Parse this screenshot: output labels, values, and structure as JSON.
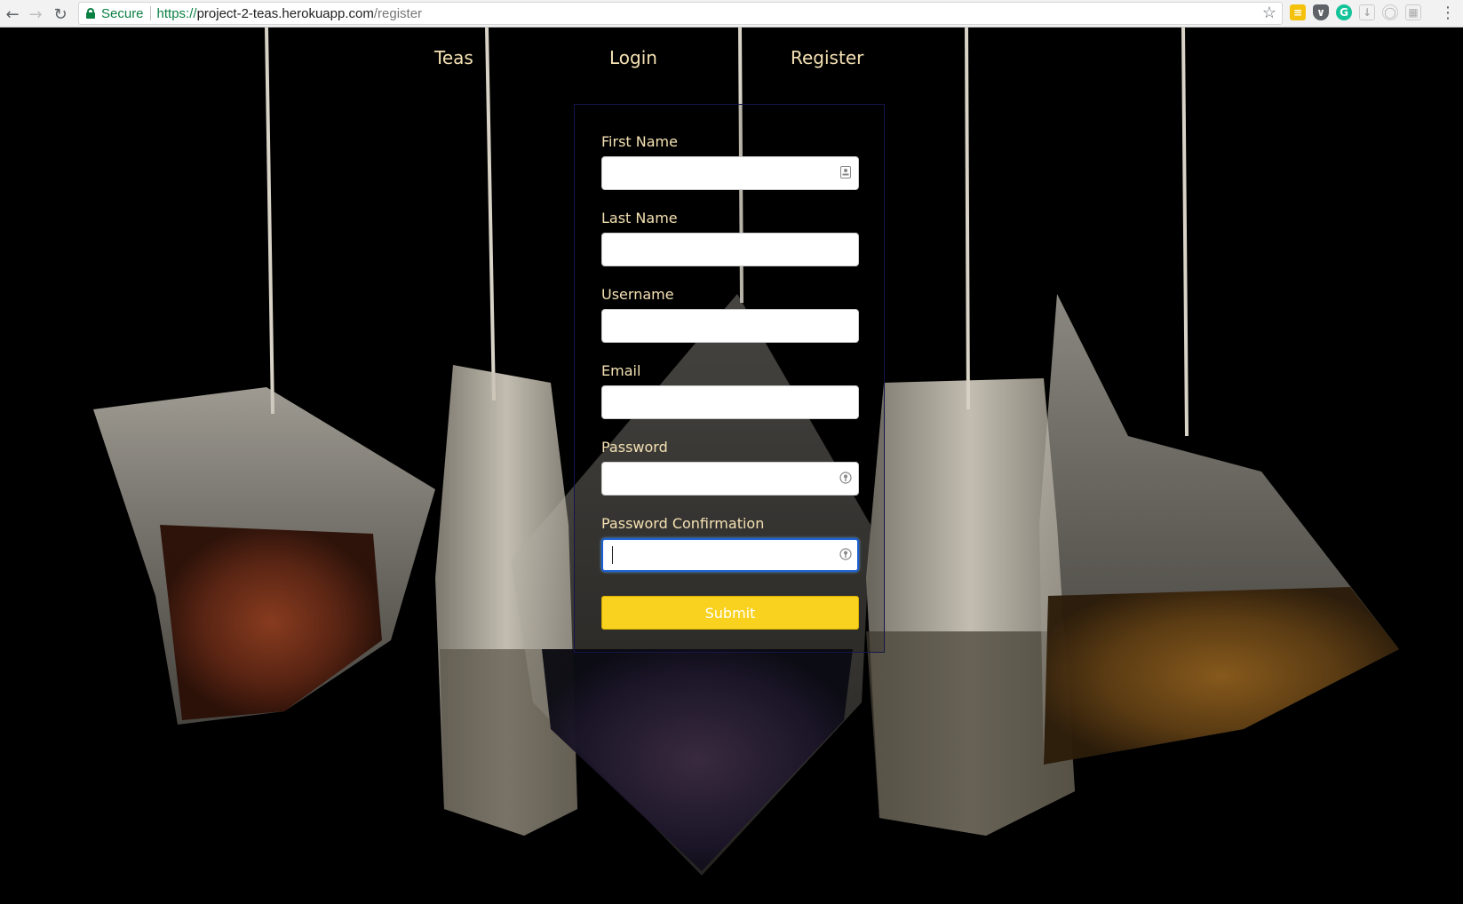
{
  "browser": {
    "secure_label": "Secure",
    "url_scheme": "https://",
    "url_host": "project-2-teas.herokuapp.com",
    "url_path": "/register"
  },
  "nav": {
    "teas": "Teas",
    "login": "Login",
    "register": "Register"
  },
  "form": {
    "first_name_label": "First Name",
    "last_name_label": "Last Name",
    "username_label": "Username",
    "email_label": "Email",
    "password_label": "Password",
    "password_confirmation_label": "Password Confirmation",
    "first_name_value": "",
    "last_name_value": "",
    "username_value": "",
    "email_value": "",
    "password_value": "",
    "password_confirmation_value": "",
    "submit_label": "Submit"
  },
  "colors": {
    "label": "#f4e1b3",
    "submit": "#f9d11f",
    "background": "#000000",
    "focus_border": "#1c5fd4"
  }
}
